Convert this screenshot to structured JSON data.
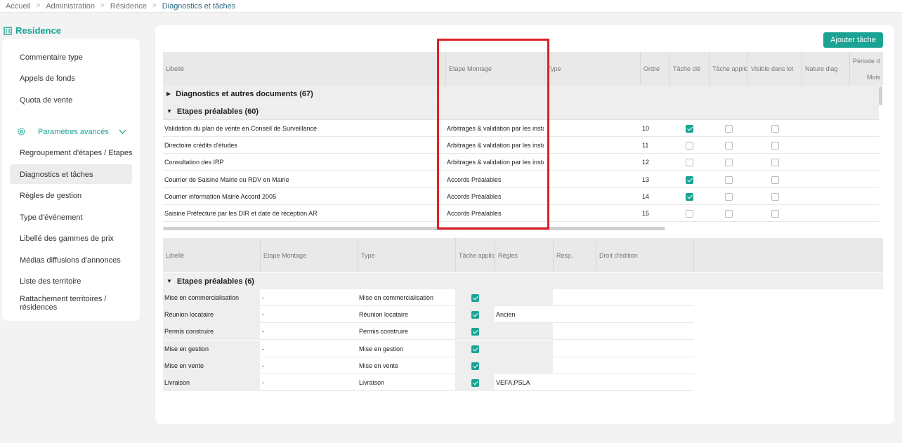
{
  "breadcrumb": [
    "Accueil",
    "Administration",
    "Résidence",
    "Diagnostics et tâches"
  ],
  "sidebar": {
    "title": "Residence",
    "items_top": [
      "Commentaire type",
      "Appels de fonds",
      "Quota de vente"
    ],
    "advanced_label": "Paramètres avancés",
    "items_adv": [
      "Regroupement d'étapes / Etapes",
      "Diagnostics et tâches",
      "Règles de gestion",
      "Type d'événement",
      "Libellé des gammes de prix",
      "Médias diffusions d'annonces",
      "Liste des territoire"
    ],
    "last_item_line1": "Rattachement territoires /",
    "last_item_line2": "résidences"
  },
  "add_button": "Ajouter tâche",
  "table1": {
    "headers": {
      "libelle": "Libellé",
      "etape": "Etape Montage",
      "type": "Type",
      "ordre": "Ordre",
      "tache_cle": "Tâche clé",
      "tache_appli": "Tâche applic",
      "visible": "Visible dans lot",
      "nature": "Nature diag",
      "periode": "Période d",
      "mois": "Mois"
    },
    "group1": "Diagnostics et autres documents (67)",
    "group2": "Etapes préalables (60)",
    "rows": [
      {
        "libelle": "Validation du plan de vente en Conseil de Surveillance",
        "etape": "Arbitrages & validation par les insta",
        "ordre": "10",
        "cle": true,
        "appli": false,
        "visible": false
      },
      {
        "libelle": "Directoire crédits d'études",
        "etape": "Arbitrages & validation par les insta",
        "ordre": "11",
        "cle": false,
        "appli": false,
        "visible": false
      },
      {
        "libelle": "Consultation des IRP",
        "etape": "Arbitrages & validation par les insta",
        "ordre": "12",
        "cle": false,
        "appli": false,
        "visible": false
      },
      {
        "libelle": "Courrier de Saisine Mairie ou RDV en Mairie",
        "etape": "Accords Préalables",
        "ordre": "13",
        "cle": true,
        "appli": false,
        "visible": false
      },
      {
        "libelle": "Courrier information Mairie Accord 2005",
        "etape": "Accords Préalables",
        "ordre": "14",
        "cle": true,
        "appli": false,
        "visible": false
      },
      {
        "libelle": "Saisine Préfecture par les DIR et date de réception AR",
        "etape": "Accords Préalables",
        "ordre": "15",
        "cle": false,
        "appli": false,
        "visible": false
      }
    ]
  },
  "table2": {
    "headers": {
      "libelle": "Libellé",
      "etape": "Etape Montage",
      "type": "Type",
      "tache_appli": "Tâche applic",
      "regles": "Règles",
      "resp": "Resp.",
      "droit": "Droit d'édition"
    },
    "group": "Etapes préalables (6)",
    "rows": [
      {
        "libelle": "Mise en commercialisation",
        "etape": "-",
        "type": "Mise en commercialisation",
        "regles": ""
      },
      {
        "libelle": "Réunion locataire",
        "etape": "-",
        "type": "Réunion locataire",
        "regles": "Ancien"
      },
      {
        "libelle": "Permis construire",
        "etape": "-",
        "type": "Permis construire",
        "regles": ""
      },
      {
        "libelle": "Mise en gestion",
        "etape": "-",
        "type": "Mise en gestion",
        "regles": ""
      },
      {
        "libelle": "Mise en vente",
        "etape": "-",
        "type": "Mise en vente",
        "regles": ""
      },
      {
        "libelle": "Livraison",
        "etape": "-",
        "type": "Livraison",
        "regles": "VEFA,PSLA"
      }
    ]
  },
  "colors": {
    "accent": "#1aa394",
    "highlight": "#e01f26"
  }
}
